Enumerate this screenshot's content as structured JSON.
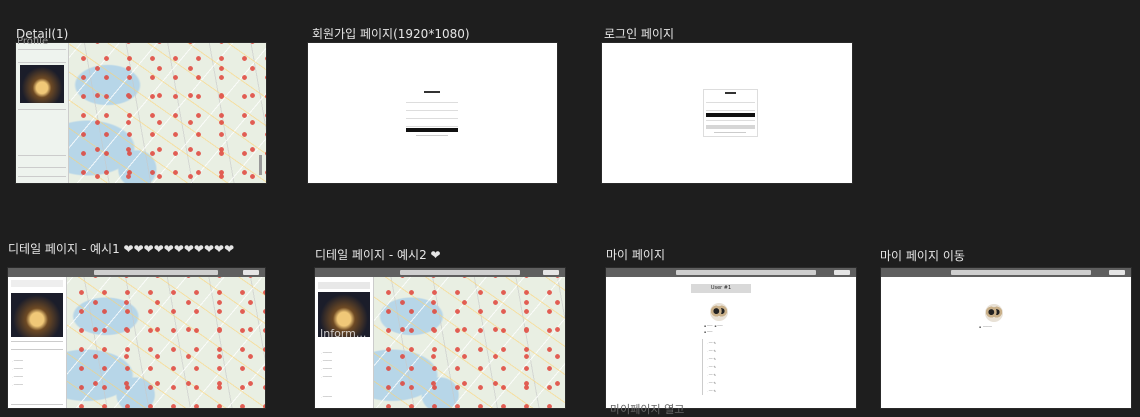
{
  "frames": [
    {
      "id": "detail1",
      "label": "Detail(1)",
      "overlay": "Profile"
    },
    {
      "id": "signup",
      "label": "회원가입 페이지(1920*1080)"
    },
    {
      "id": "login",
      "label": "로그인 페이지"
    },
    {
      "id": "detail-ex1",
      "label": "디테일 페이지 - 예시1 ❤❤❤❤❤❤❤❤❤❤❤"
    },
    {
      "id": "detail-ex2",
      "label": "디테일 페이지 - 예시2 ❤",
      "overlay": "Inform..."
    },
    {
      "id": "mypage",
      "label": "마이 페이지",
      "user_title": "User #1",
      "bottom_text": "마이페이지 열고"
    },
    {
      "id": "mypage-move",
      "label": "마이 페이지 이동"
    }
  ]
}
